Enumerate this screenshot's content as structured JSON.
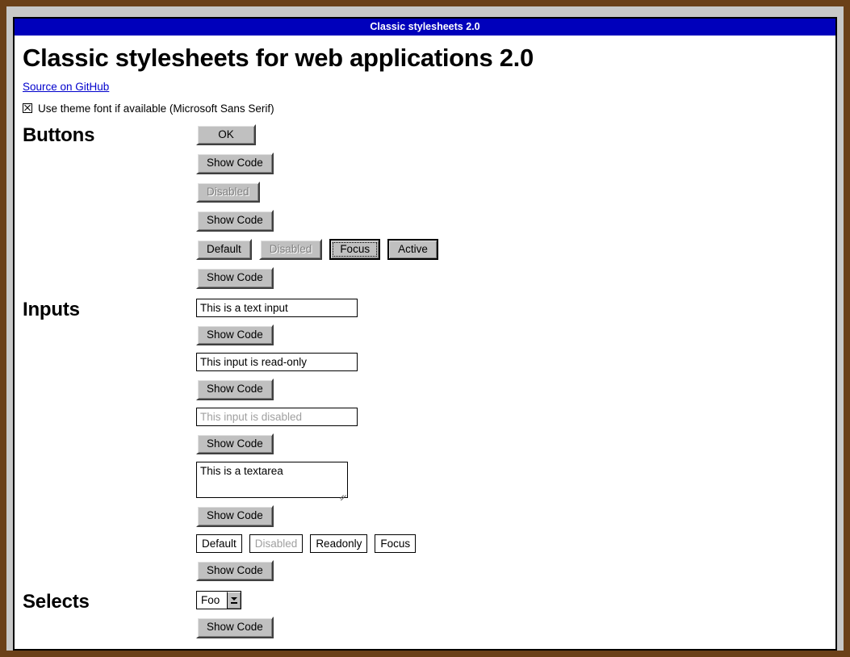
{
  "window": {
    "titlebar": "Classic stylesheets 2.0"
  },
  "page": {
    "heading": "Classic stylesheets for web applications 2.0",
    "source_link": "Source on GitHub",
    "theme_font_label": "Use theme font if available (Microsoft Sans Serif)",
    "theme_font_checked": true
  },
  "colors": {
    "desktop": "#6b4018",
    "frame": "#c8c8c8",
    "titlebar": "#0000bb",
    "titlebar_text": "#ffffff",
    "button_face": "#c0c0c0",
    "link": "#0000cc",
    "disabled_text": "#808080"
  },
  "sections": [
    {
      "title": "Buttons",
      "rows": [
        {
          "kind": "buttons",
          "items": [
            {
              "label": "OK",
              "state": "ok"
            }
          ]
        },
        {
          "kind": "buttons",
          "items": [
            {
              "label": "Show Code",
              "state": "default"
            }
          ]
        },
        {
          "kind": "buttons",
          "items": [
            {
              "label": "Disabled",
              "state": "disabled"
            }
          ]
        },
        {
          "kind": "buttons",
          "items": [
            {
              "label": "Show Code",
              "state": "default"
            }
          ]
        },
        {
          "kind": "buttons",
          "items": [
            {
              "label": "Default",
              "state": "default"
            },
            {
              "label": "Disabled",
              "state": "disabled"
            },
            {
              "label": "Focus",
              "state": "focus"
            },
            {
              "label": "Active",
              "state": "active"
            }
          ]
        },
        {
          "kind": "buttons",
          "items": [
            {
              "label": "Show Code",
              "state": "default"
            }
          ]
        }
      ]
    },
    {
      "title": "Inputs",
      "rows": [
        {
          "kind": "input",
          "value": "This is a text input",
          "state": "default",
          "width": "wide"
        },
        {
          "kind": "buttons",
          "items": [
            {
              "label": "Show Code",
              "state": "default"
            }
          ]
        },
        {
          "kind": "input",
          "value": "This input is read-only",
          "state": "readonly",
          "width": "wide"
        },
        {
          "kind": "buttons",
          "items": [
            {
              "label": "Show Code",
              "state": "default"
            }
          ]
        },
        {
          "kind": "input",
          "value": "This input is disabled",
          "state": "disabled",
          "width": "wide"
        },
        {
          "kind": "buttons",
          "items": [
            {
              "label": "Show Code",
              "state": "default"
            }
          ]
        },
        {
          "kind": "textarea",
          "value": "This is a textarea"
        },
        {
          "kind": "buttons",
          "items": [
            {
              "label": "Show Code",
              "state": "default"
            }
          ]
        },
        {
          "kind": "inputs",
          "items": [
            {
              "value": "Default",
              "state": "default"
            },
            {
              "value": "Disabled",
              "state": "disabled"
            },
            {
              "value": "Readonly",
              "state": "readonly"
            },
            {
              "value": "Focus",
              "state": "focus"
            }
          ]
        },
        {
          "kind": "buttons",
          "items": [
            {
              "label": "Show Code",
              "state": "default"
            }
          ]
        }
      ]
    },
    {
      "title": "Selects",
      "rows": [
        {
          "kind": "select",
          "value": "Foo"
        },
        {
          "kind": "buttons",
          "items": [
            {
              "label": "Show Code",
              "state": "default"
            }
          ]
        }
      ]
    }
  ]
}
